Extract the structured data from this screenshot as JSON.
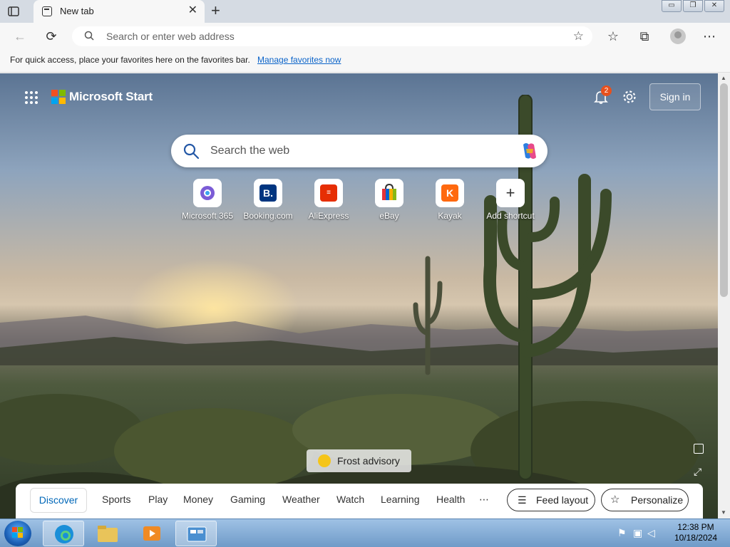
{
  "tab": {
    "title": "New tab",
    "close": "✕",
    "new": "+"
  },
  "window": {
    "minimize": "▭",
    "restore": "❐",
    "close": "✕"
  },
  "toolbar": {
    "back": "←",
    "reload": "⟳",
    "address_placeholder": "Search or enter web address",
    "favorites": "☆",
    "collections": "⧉",
    "more": "⋯"
  },
  "favbar": {
    "text": "For quick access, place your favorites here on the favorites bar.",
    "link": "Manage favorites now"
  },
  "header": {
    "brand": "Microsoft Start",
    "notifications": "2",
    "signin": "Sign in"
  },
  "search": {
    "placeholder": "Search the web"
  },
  "shortcuts": [
    {
      "label": "Microsoft 365",
      "icon": "microsoft-365-icon"
    },
    {
      "label": "Booking.com",
      "glyph": "B.",
      "color": "#003580"
    },
    {
      "label": "AliExpress",
      "glyph": "≡",
      "color": "#e62e04"
    },
    {
      "label": "eBay",
      "icon": "ebay-bag-icon"
    },
    {
      "label": "Kayak",
      "glyph": "K",
      "color": "#ff690f"
    },
    {
      "label": "Add shortcut",
      "glyph": "+"
    }
  ],
  "advisory": {
    "text": "Frost advisory"
  },
  "feed": {
    "active": "Discover",
    "items": [
      "Sports",
      "Play",
      "Money",
      "Gaming",
      "Weather",
      "Watch",
      "Learning",
      "Health"
    ],
    "more": "⋯",
    "feed_layout": "Feed layout",
    "personalize": "Personalize"
  },
  "taskbar": {
    "time": "12:38 PM",
    "date": "10/18/2024"
  },
  "colors": {
    "accent": "#0067b8",
    "badge": "#e8501c",
    "link": "#0a63c9"
  }
}
